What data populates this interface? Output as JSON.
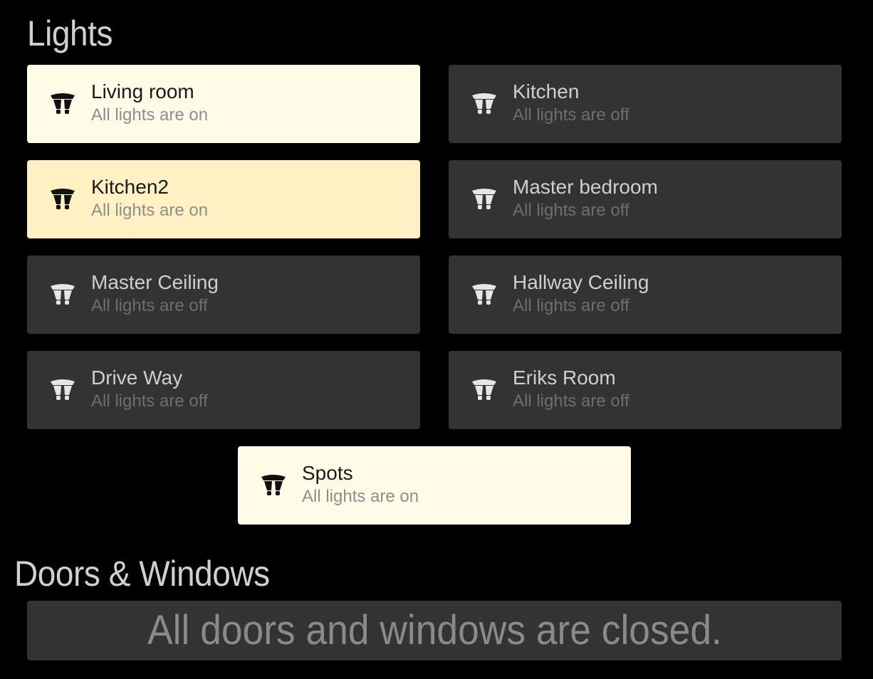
{
  "lights": {
    "title": "Lights",
    "rooms": [
      {
        "name": "Living room",
        "status": "All lights are on"
      },
      {
        "name": "Kitchen",
        "status": "All lights are off"
      },
      {
        "name": "Kitchen2",
        "status": "All lights are on"
      },
      {
        "name": "Master bedroom",
        "status": "All lights are off"
      },
      {
        "name": "Master Ceiling",
        "status": "All lights are off"
      },
      {
        "name": "Hallway Ceiling",
        "status": "All lights are off"
      },
      {
        "name": "Drive Way",
        "status": "All lights are off"
      },
      {
        "name": "Eriks Room",
        "status": "All lights are off"
      },
      {
        "name": "Spots",
        "status": "All lights are on"
      }
    ]
  },
  "doors_windows": {
    "title": "Doors & Windows",
    "message": "All doors and windows are closed."
  },
  "icons": {
    "room_tile": "spotlight-bulb-icon"
  },
  "colors": {
    "background": "#000000",
    "tile_off": "#333333",
    "tile_on": "#fffbe6",
    "tile_on_warm": "#fff1c4",
    "title_text": "#d0d0d0"
  }
}
